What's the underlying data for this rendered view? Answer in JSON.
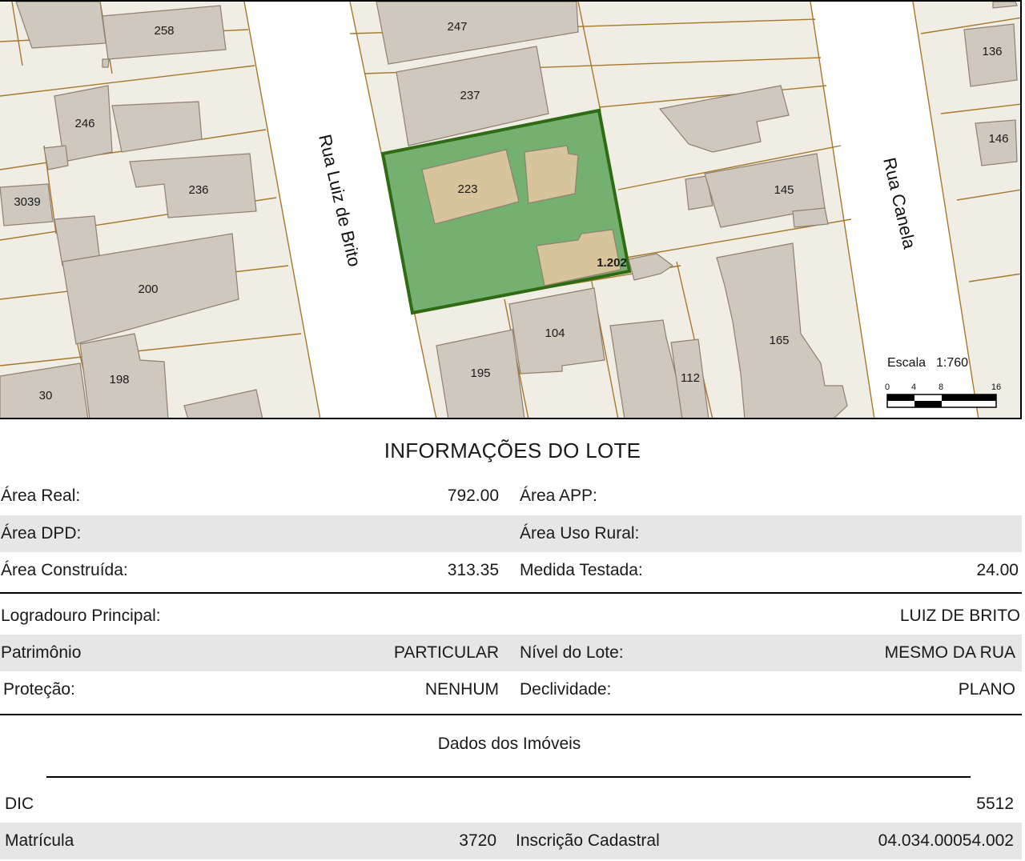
{
  "map": {
    "streets": [
      "Rua Luiz de Brito",
      "Rua Canela"
    ],
    "lot_numbers": [
      "258",
      "247",
      "136",
      "237",
      "246",
      "146",
      "223",
      "145",
      "236",
      "3039",
      "1.202",
      "200",
      "104",
      "165",
      "195",
      "112",
      "198",
      "30"
    ],
    "scale_label": "Escala",
    "scale_value": "1:760",
    "scale_ticks": [
      "0",
      "4",
      "8",
      "16"
    ]
  },
  "info": {
    "title": "INFORMAÇÕES DO LOTE",
    "area_real_label": "Área Real:",
    "area_real_value": "792.00",
    "area_app_label": "Área APP:",
    "area_app_value": "",
    "area_dpd_label": "Área DPD:",
    "area_dpd_value": "",
    "area_uso_rural_label": "Área Uso Rural:",
    "area_uso_rural_value": "",
    "area_construida_label": "Área Construída:",
    "area_construida_value": "313.35",
    "medida_testada_label": "Medida Testada:",
    "medida_testada_value": "24.00",
    "logradouro_label": "Logradouro Principal:",
    "logradouro_value": "LUIZ DE BRITO",
    "patrimonio_label": "Patrimônio",
    "patrimonio_value": "PARTICULAR",
    "nivel_label": "Nível do Lote:",
    "nivel_value": "MESMO DA RUA",
    "protecao_label": "Proteção:",
    "protecao_value": "NENHUM",
    "declividade_label": "Declividade:",
    "declividade_value": "PLANO"
  },
  "imoveis": {
    "subtitle": "Dados dos Imóveis",
    "dic_label": "DIC",
    "dic_value": "5512",
    "matricula_label": "Matrícula",
    "matricula_value": "3720",
    "inscricao_label": "Inscrição Cadastral",
    "inscricao_value": "04.034.00054.002"
  },
  "colors": {
    "parcel": "#f0ede4",
    "parcel_line": "#a8782a",
    "building": "#cfc8be",
    "building_line": "#8f8070",
    "highlight_fill": "#74b06f",
    "highlight_line": "#2e6b12",
    "highlight_building": "#d8c49a",
    "street": "#ffffff"
  }
}
